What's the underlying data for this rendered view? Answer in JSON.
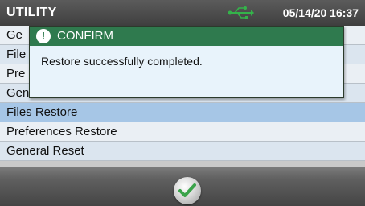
{
  "header": {
    "title": "UTILITY",
    "datetime": "05/14/20 16:37",
    "status_icon": "usb-icon"
  },
  "list": {
    "items": [
      {
        "label": "Ge",
        "partial": true
      },
      {
        "label": "File",
        "partial": true
      },
      {
        "label": "Pre",
        "partial": true
      },
      {
        "label": "General Restore",
        "partial": true
      },
      {
        "label": "Files Restore",
        "selected": true
      },
      {
        "label": "Preferences Restore"
      },
      {
        "label": "General Reset"
      }
    ]
  },
  "dialog": {
    "title": "CONFIRM",
    "icon": "exclamation-icon",
    "message": "Restore successfully completed.",
    "header_color": "#2f7a4e"
  },
  "footer": {
    "ok_icon": "checkmark-icon",
    "ok_color": "#3aa34a"
  }
}
